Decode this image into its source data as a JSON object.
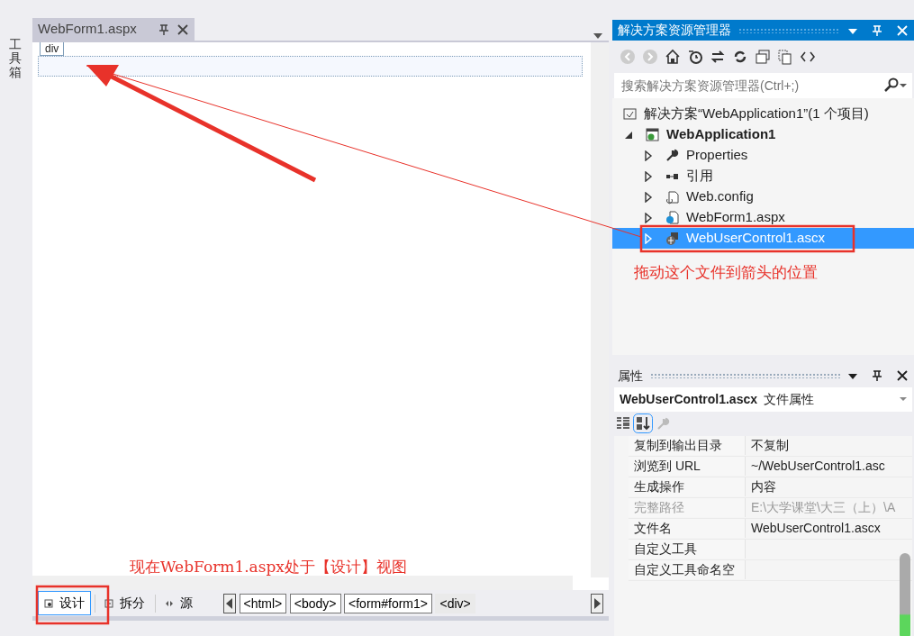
{
  "toolbox_label": "工具箱",
  "document_tab": {
    "title": "WebForm1.aspx"
  },
  "design_surface": {
    "element_tag": "div"
  },
  "view_tabs": [
    {
      "label": "设计",
      "selected": true
    },
    {
      "label": "拆分",
      "selected": false
    },
    {
      "label": "源",
      "selected": false
    }
  ],
  "breadcrumbs": [
    {
      "label": "<html>",
      "selected": false
    },
    {
      "label": "<body>",
      "selected": false
    },
    {
      "label": "<form#form1>",
      "selected": false
    },
    {
      "label": "<div>",
      "selected": true
    }
  ],
  "solution_explorer": {
    "title": "解决方案资源管理器",
    "search": {
      "placeholder": "搜索解决方案资源管理器(Ctrl+;)"
    },
    "tree": [
      {
        "kind": "solution",
        "label": "解决方案“WebApplication1”(1 个项目)",
        "selected": false,
        "children": [
          {
            "kind": "project",
            "label": "WebApplication1",
            "expanded": true,
            "selected": false,
            "children": [
              {
                "kind": "properties",
                "label": "Properties",
                "expanded": false,
                "selected": false
              },
              {
                "kind": "references",
                "label": "引用",
                "expanded": false,
                "selected": false
              },
              {
                "kind": "config",
                "label": "Web.config",
                "expanded": false,
                "selected": false
              },
              {
                "kind": "webform",
                "label": "WebForm1.aspx",
                "expanded": false,
                "selected": false
              },
              {
                "kind": "usercontrol",
                "label": "WebUserControl1.ascx",
                "expanded": false,
                "selected": true
              }
            ]
          }
        ]
      }
    ]
  },
  "annotations": [
    {
      "text": "拖动这个文件到箭头的位置"
    },
    {
      "text": "现在WebForm1.aspx处于【设计】视图"
    }
  ],
  "properties": {
    "title": "属性",
    "object_name": "WebUserControl1.ascx",
    "object_type": "文件属性",
    "rows": [
      {
        "name": "复制到输出目录",
        "value": "不复制",
        "disabled": false
      },
      {
        "name": "浏览到 URL",
        "value": "~/WebUserControl1.asc",
        "disabled": false
      },
      {
        "name": "生成操作",
        "value": "内容",
        "disabled": false
      },
      {
        "name": "完整路径",
        "value": "E:\\大学课堂\\大三（上）\\A",
        "disabled": true
      },
      {
        "name": "文件名",
        "value": "WebUserControl1.ascx",
        "disabled": false
      },
      {
        "name": "自定义工具",
        "value": "",
        "disabled": false
      },
      {
        "name": "自定义工具命名空",
        "value": "",
        "disabled": false
      }
    ]
  }
}
